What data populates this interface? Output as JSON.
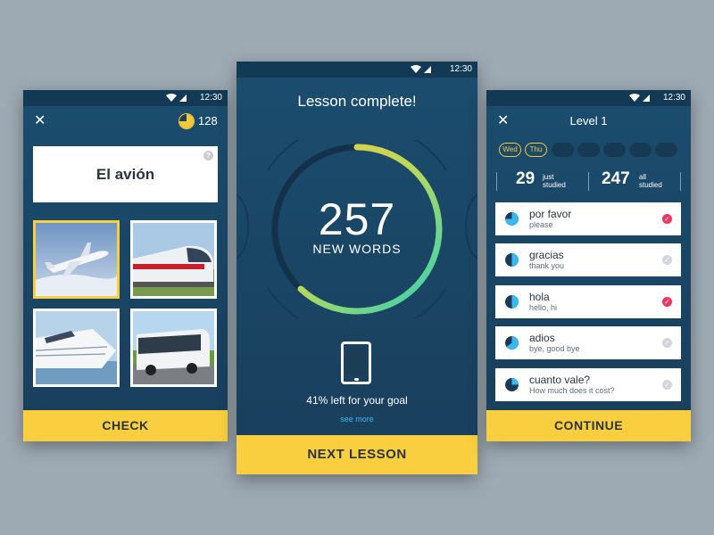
{
  "status_bar": {
    "time": "12:30"
  },
  "quiz_screen": {
    "coins": "128",
    "word": "El avión",
    "help_symbol": "?",
    "options": [
      {
        "image": "airplane",
        "selected": true
      },
      {
        "image": "train",
        "selected": false
      },
      {
        "image": "cruise-ship",
        "selected": false
      },
      {
        "image": "bus",
        "selected": false
      }
    ],
    "button_label": "CHECK"
  },
  "complete_screen": {
    "title": "Lesson complete!",
    "count": "257",
    "count_label": "NEW WORDS",
    "progress": 0.62,
    "goal_text": "41% left for your goal",
    "see_more": "see more",
    "button_label": "NEXT LESSON"
  },
  "level_screen": {
    "title": "Level 1",
    "days": [
      {
        "label": "Wed",
        "active": true
      },
      {
        "label": "Thu",
        "active": true
      },
      {
        "label": "",
        "active": false
      },
      {
        "label": "",
        "active": false
      },
      {
        "label": "",
        "active": false
      },
      {
        "label": "",
        "active": false
      },
      {
        "label": "",
        "active": false
      }
    ],
    "just_studied": {
      "value": "29",
      "label_line1": "just",
      "label_line2": "studied"
    },
    "all_studied": {
      "value": "247",
      "label_line1": "all",
      "label_line2": "studied"
    },
    "words": [
      {
        "word": "por favor",
        "translation": "please",
        "progress": 0.75,
        "marked": true
      },
      {
        "word": "gracias",
        "translation": "thank you",
        "progress": 0.5,
        "marked": false
      },
      {
        "word": "hola",
        "translation": "hello, hi",
        "progress": 0.5,
        "marked": true
      },
      {
        "word": "adios",
        "translation": "bye, good bye",
        "progress": 0.65,
        "marked": false
      },
      {
        "word": "cuanto vale?",
        "translation": "How much does it cost?",
        "progress": 0.25,
        "marked": false
      }
    ],
    "button_label": "CONTINUE"
  },
  "colors": {
    "accent_yellow": "#f9cf3f",
    "check_pink": "#f0365f",
    "check_grey": "#d2d6da",
    "pie_blue": "#3ab8f2",
    "pie_dark": "#1c3a55"
  }
}
